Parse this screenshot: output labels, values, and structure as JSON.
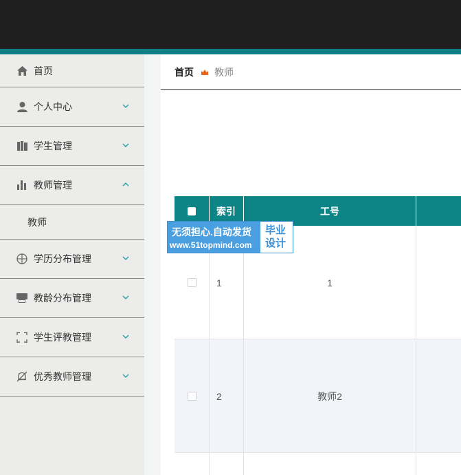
{
  "sidebar": {
    "items": [
      {
        "label": "首页",
        "icon": "home-icon"
      },
      {
        "label": "个人中心",
        "icon": "user-icon"
      },
      {
        "label": "学生管理",
        "icon": "book-icon"
      },
      {
        "label": "教师管理",
        "icon": "bar-chart-icon"
      },
      {
        "label": "学历分布管理",
        "icon": "target-icon"
      },
      {
        "label": "教龄分布管理",
        "icon": "printer-icon"
      },
      {
        "label": "学生评教管理",
        "icon": "frame-icon"
      },
      {
        "label": "优秀教师管理",
        "icon": "bell-off-icon"
      }
    ],
    "submenu": {
      "label": "教师"
    }
  },
  "breadcrumb": {
    "home": "首页",
    "current": "教师"
  },
  "table": {
    "headers": {
      "index": "索引",
      "job_no": "工号"
    },
    "rows": [
      {
        "index": "1",
        "job_no": "1"
      },
      {
        "index": "2",
        "job_no": "教师2"
      }
    ]
  },
  "watermark": {
    "line1": "无须担心.自动发货",
    "line2": "www.51topmind.com",
    "badge_line1": "毕业",
    "badge_line2": "设计"
  },
  "colors": {
    "accent": "#0d8486",
    "topbar": "#1f1f1f",
    "breadcrumb_icon": "#e8641c"
  }
}
